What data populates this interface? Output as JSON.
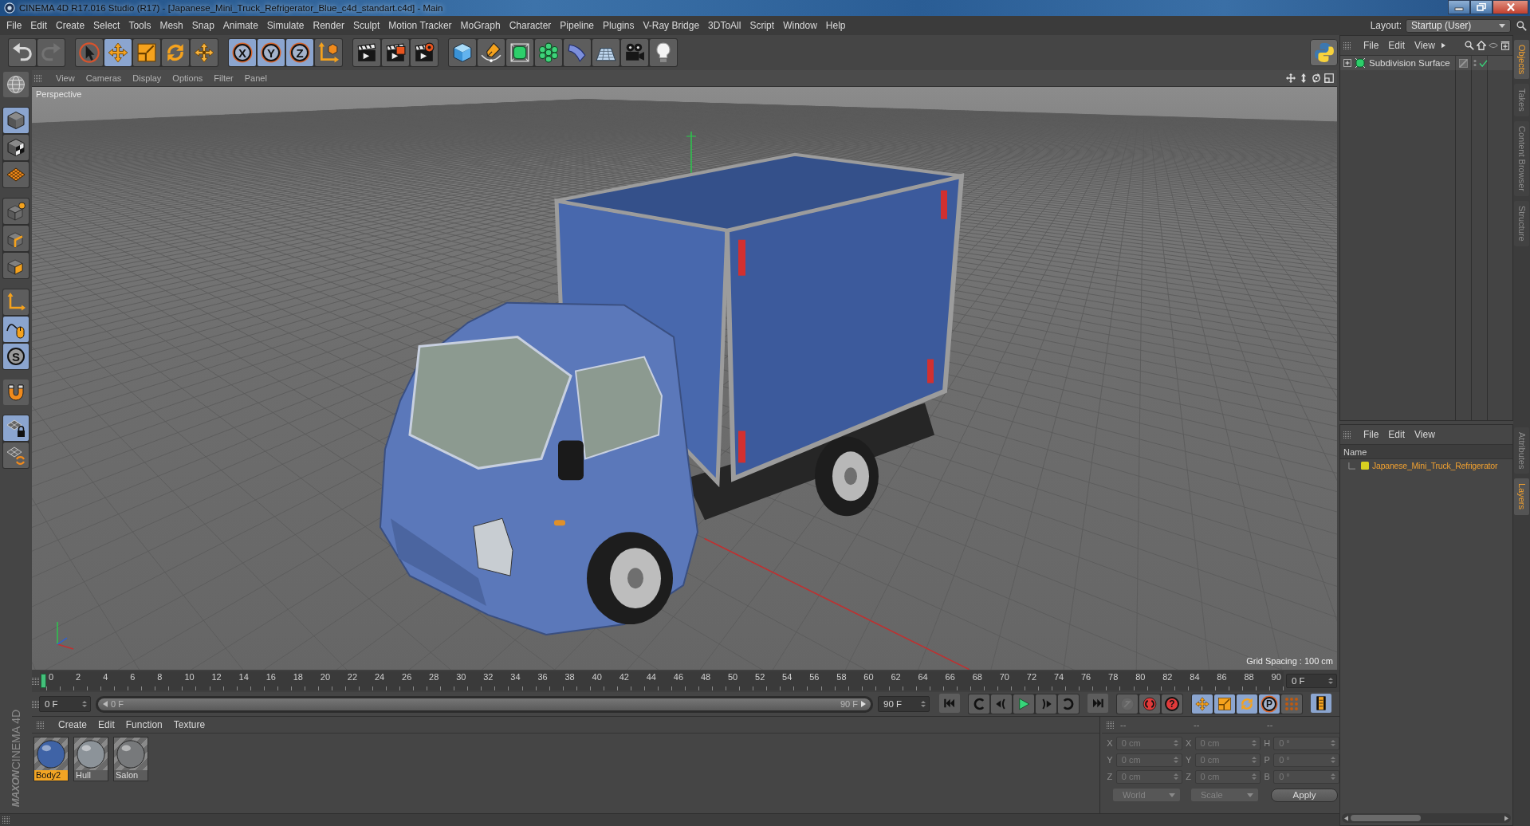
{
  "window": {
    "title": "CINEMA 4D R17.016 Studio (R17) - [Japanese_Mini_Truck_Refrigerator_Blue_c4d_standart.c4d] - Main"
  },
  "menu_bar": {
    "items": [
      "File",
      "Edit",
      "Create",
      "Select",
      "Tools",
      "Mesh",
      "Snap",
      "Animate",
      "Simulate",
      "Render",
      "Sculpt",
      "Motion Tracker",
      "MoGraph",
      "Character",
      "Pipeline",
      "Plugins",
      "V-Ray Bridge",
      "3DToAll",
      "Script",
      "Window",
      "Help"
    ],
    "layout_label": "Layout:",
    "layout_value": "Startup (User)"
  },
  "toolbar": {
    "groups": [
      {
        "tools": [
          {
            "kind": "undo",
            "selected": false,
            "disabled": false
          },
          {
            "kind": "redo",
            "selected": false,
            "disabled": true
          }
        ]
      },
      {
        "tools": [
          {
            "kind": "select",
            "selected": false,
            "disabled": false
          },
          {
            "kind": "move",
            "selected": true,
            "disabled": false
          },
          {
            "kind": "scale",
            "selected": false,
            "disabled": false
          },
          {
            "kind": "rotate",
            "selected": false,
            "disabled": false
          },
          {
            "kind": "transform",
            "selected": false,
            "disabled": false
          }
        ]
      },
      {
        "tools": [
          {
            "kind": "axis",
            "label": "X",
            "selected": true,
            "disabled": false
          },
          {
            "kind": "axis",
            "label": "Y",
            "selected": true,
            "disabled": false
          },
          {
            "kind": "axis",
            "label": "Z",
            "selected": true,
            "disabled": false
          },
          {
            "kind": "coords",
            "selected": false,
            "disabled": false
          }
        ]
      },
      {
        "tools": [
          {
            "kind": "render",
            "selected": false,
            "disabled": false
          },
          {
            "kind": "picture",
            "selected": false,
            "disabled": false
          },
          {
            "kind": "settings",
            "selected": false,
            "disabled": false
          }
        ]
      },
      {
        "tools": [
          {
            "kind": "cube",
            "selected": false,
            "disabled": false
          },
          {
            "kind": "pen",
            "selected": false,
            "disabled": false
          },
          {
            "kind": "subdivide",
            "selected": false,
            "disabled": false
          },
          {
            "kind": "cloner",
            "selected": false,
            "disabled": false
          },
          {
            "kind": "deformer",
            "selected": false,
            "disabled": false
          },
          {
            "kind": "floor",
            "selected": false,
            "disabled": false
          },
          {
            "kind": "camera",
            "selected": false,
            "disabled": false
          },
          {
            "kind": "light",
            "selected": false,
            "disabled": false
          }
        ]
      }
    ]
  },
  "left_toolbar": {
    "groups": [
      {
        "tools": [
          {
            "kind": "globe",
            "selected": false
          }
        ]
      },
      {
        "tools": [
          {
            "kind": "model",
            "selected": true
          },
          {
            "kind": "texture",
            "selected": false
          },
          {
            "kind": "workplane",
            "selected": false
          }
        ]
      },
      {
        "tools": [
          {
            "kind": "points",
            "selected": false
          },
          {
            "kind": "edges",
            "selected": false
          },
          {
            "kind": "polygons",
            "selected": false
          }
        ]
      },
      {
        "tools": [
          {
            "kind": "axes",
            "selected": false
          },
          {
            "kind": "tweak",
            "selected": true
          },
          {
            "kind": "snap",
            "label": "S",
            "selected": true
          }
        ]
      },
      {
        "tools": [
          {
            "kind": "magnet",
            "selected": false
          }
        ]
      },
      {
        "tools": [
          {
            "kind": "gridlock",
            "selected": true
          },
          {
            "kind": "gridrotate",
            "selected": false
          }
        ]
      }
    ]
  },
  "viewport": {
    "menu": [
      "View",
      "Cameras",
      "Display",
      "Options",
      "Filter",
      "Panel"
    ],
    "camera": "Perspective",
    "grid_spacing": "Grid Spacing : 100 cm"
  },
  "timeline": {
    "frames": [
      "0",
      "2",
      "4",
      "6",
      "8",
      "10",
      "12",
      "14",
      "16",
      "18",
      "20",
      "22",
      "24",
      "26",
      "28",
      "30",
      "32",
      "34",
      "36",
      "38",
      "40",
      "42",
      "44",
      "46",
      "48",
      "50",
      "52",
      "54",
      "56",
      "58",
      "60",
      "62",
      "64",
      "66",
      "68",
      "70",
      "72",
      "74",
      "76",
      "78",
      "80",
      "82",
      "84",
      "86",
      "88",
      "90"
    ],
    "level": 0,
    "current_frame": "0 F"
  },
  "transport": {
    "start_frame": "0 F",
    "range_slider": {
      "start_label": "0 F",
      "end_label": "90 F",
      "level": 1
    },
    "end_frame": "90 F",
    "groups": [
      {
        "buttons": [
          {
            "kind": "start",
            "selected": false,
            "disabled": false
          }
        ]
      },
      {
        "buttons": [
          {
            "kind": "prevkey",
            "selected": false,
            "disabled": false
          },
          {
            "kind": "prevframe",
            "selected": false,
            "disabled": false
          },
          {
            "kind": "play",
            "selected": false,
            "disabled": false
          },
          {
            "kind": "nextframe",
            "selected": false,
            "disabled": false
          },
          {
            "kind": "nextkey",
            "selected": false,
            "disabled": false
          }
        ]
      },
      {
        "buttons": [
          {
            "kind": "end",
            "selected": false,
            "disabled": false
          }
        ]
      },
      {
        "buttons": [
          {
            "kind": "record",
            "selected": false,
            "disabled": true
          },
          {
            "kind": "autokey",
            "selected": false,
            "disabled": false
          },
          {
            "kind": "help",
            "label": "?",
            "selected": false,
            "disabled": false
          }
        ]
      },
      {
        "buttons": [
          {
            "kind": "kmove",
            "selected": true,
            "disabled": false
          },
          {
            "kind": "kscale",
            "selected": true,
            "disabled": false
          },
          {
            "kind": "krotate",
            "selected": true,
            "disabled": false
          },
          {
            "kind": "param",
            "label": "P",
            "selected": true,
            "disabled": false
          },
          {
            "kind": "kpoints",
            "selected": false,
            "disabled": false
          }
        ]
      },
      {
        "buttons": [
          {
            "kind": "timeline",
            "selected": true,
            "disabled": false
          }
        ]
      }
    ]
  },
  "material_manager": {
    "menu": [
      "Create",
      "Edit",
      "Function",
      "Texture"
    ],
    "materials": [
      {
        "name": "Body2",
        "color": "#3f63a6",
        "selected": true
      },
      {
        "name": "Hull",
        "color": "#8c9399",
        "selected": false
      },
      {
        "name": "Salon",
        "color": "#77797b",
        "selected": false
      }
    ]
  },
  "coordinates": {
    "disabled": true,
    "headers": [
      "--",
      "--",
      "--"
    ],
    "rows": [
      {
        "position_axis": "X",
        "position": "0 cm",
        "size_axis": "X",
        "size": "0 cm",
        "rotation_axis": "H",
        "rotation": "0 °"
      },
      {
        "position_axis": "Y",
        "position": "0 cm",
        "size_axis": "Y",
        "size": "0 cm",
        "rotation_axis": "P",
        "rotation": "0 °"
      },
      {
        "position_axis": "Z",
        "position": "0 cm",
        "size_axis": "Z",
        "size": "0 cm",
        "rotation_axis": "B",
        "rotation": "0 °"
      }
    ],
    "coordinate_system": "World",
    "size_mode": "Scale",
    "apply": "Apply"
  },
  "objects_manager": {
    "menu": [
      "File",
      "Edit",
      "View"
    ],
    "objects": [
      {
        "name": "Subdivision Surface",
        "expanded": false,
        "enabled": true
      }
    ]
  },
  "layers_manager": {
    "menu": [
      "File",
      "Edit",
      "View"
    ],
    "column": "Name",
    "layers": [
      {
        "name": "Japanese_Mini_Truck_Refrigerator",
        "color": "#d8d020",
        "selected": true
      }
    ]
  },
  "side_tabs": {
    "top": [
      {
        "label": "Objects",
        "selected": true
      },
      {
        "label": "Takes",
        "selected": false
      },
      {
        "label": "Content Browser",
        "selected": false
      },
      {
        "label": "Structure",
        "selected": false
      }
    ],
    "bottom": [
      {
        "label": "Attributes",
        "selected": false
      },
      {
        "label": "Layers",
        "selected": true
      }
    ]
  },
  "logo": {
    "brand": "MAXON",
    "product": "CINEMA 4D"
  }
}
